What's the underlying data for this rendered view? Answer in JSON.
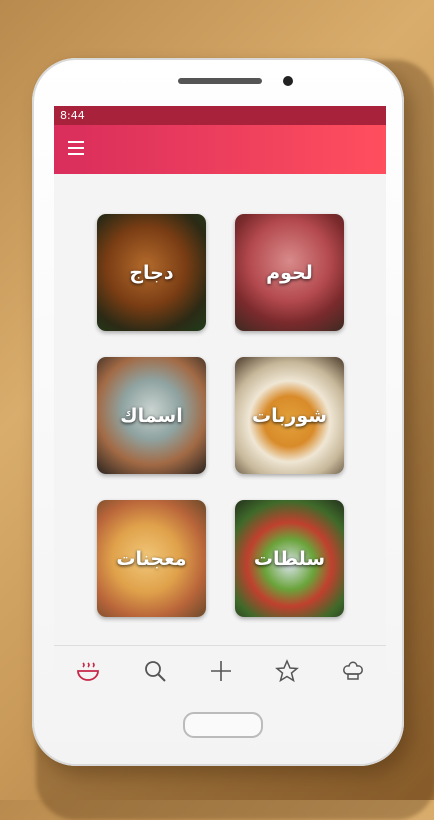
{
  "status": {
    "time": "8:44"
  },
  "categories": [
    {
      "label": "دجاج"
    },
    {
      "label": "لحوم"
    },
    {
      "label": "اسماك"
    },
    {
      "label": "شوربات"
    },
    {
      "label": "معجنات"
    },
    {
      "label": "سلطات"
    }
  ],
  "bottom_nav": [
    "soup-bowl-icon",
    "search-icon",
    "add-icon",
    "star-icon",
    "chef-hat-icon"
  ],
  "colors": {
    "appbar_start": "#d92d5c",
    "appbar_end": "#ff4f5e",
    "statusbar": "#a8223b",
    "active_icon": "#c62848"
  }
}
